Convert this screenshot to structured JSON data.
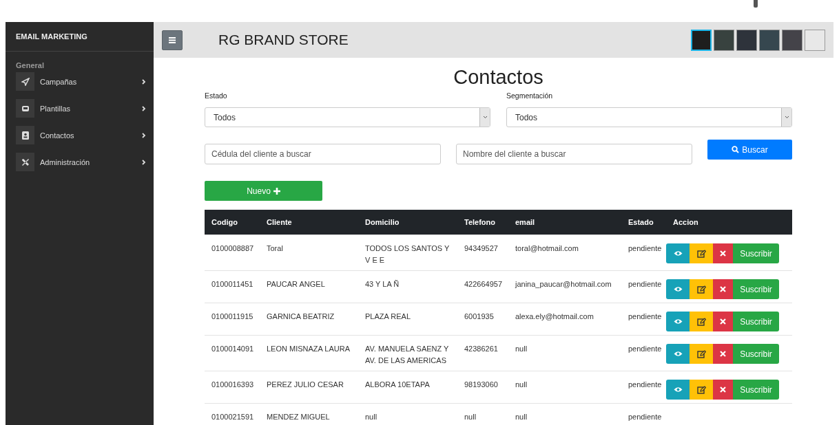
{
  "sidebar": {
    "title": "EMAIL MARKETING",
    "section": "General",
    "items": [
      {
        "label": "Campañas",
        "kind": "send"
      },
      {
        "label": "Plantillas",
        "kind": "template"
      },
      {
        "label": "Contactos",
        "kind": "contact"
      },
      {
        "label": "Administración",
        "kind": "tools"
      }
    ]
  },
  "header": {
    "title": "RG BRAND STORE",
    "themes": [
      {
        "color": "#1e1e1e",
        "selected": true
      },
      {
        "color": "#38423f",
        "selected": false
      },
      {
        "color": "#2e333b",
        "selected": false
      },
      {
        "color": "#36474f",
        "selected": false
      },
      {
        "color": "#444349",
        "selected": false
      },
      {
        "color": "#e8e8e8",
        "selected": false
      }
    ]
  },
  "page": {
    "title": "Contactos",
    "filters": [
      {
        "label": "Estado",
        "value": "Todos"
      },
      {
        "label": "Segmentación",
        "value": "Todos"
      }
    ],
    "search": [
      {
        "placeholder": "Cédula del cliente a buscar"
      },
      {
        "placeholder": "Nombre del cliente a buscar"
      }
    ],
    "search_button": "Buscar",
    "new_button": "Nuevo"
  },
  "table": {
    "columns": [
      "Codigo",
      "Cliente",
      "Domicilio",
      "Telefono",
      "email",
      "Estado",
      "Accion"
    ],
    "rows": [
      {
        "cells": [
          "0100008887",
          "Toral",
          "TODOS LOS SANTOS Y V E E",
          "94349527",
          "toral@hotmail.com",
          "pendiente"
        ],
        "action": "Suscribir"
      },
      {
        "cells": [
          "0100011451",
          "PAUCAR ANGEL",
          "43 Y LA Ñ",
          "422664957",
          "janina_paucar@hotmail.com",
          "pendiente"
        ],
        "action": "Suscribir"
      },
      {
        "cells": [
          "0100011915",
          "GARNICA BEATRIZ",
          "PLAZA REAL",
          "6001935",
          "alexa.ely@hotmail.com",
          "pendiente"
        ],
        "action": "Suscribir"
      },
      {
        "cells": [
          "0100014091",
          "LEON MISNAZA LAURA",
          "AV. MANUELA SAENZ Y AV. DE LAS AMERICAS",
          "42386261",
          "null",
          "pendiente"
        ],
        "action": "Suscribir"
      },
      {
        "cells": [
          "0100016393",
          "PEREZ JULIO CESAR",
          "ALBORA 10ETAPA",
          "98193060",
          "null",
          "pendiente"
        ],
        "action": "Suscribir"
      },
      {
        "cells": [
          "0100021591",
          "MENDEZ MIGUEL",
          "null",
          "null",
          "null",
          "pendiente"
        ]
      }
    ]
  }
}
